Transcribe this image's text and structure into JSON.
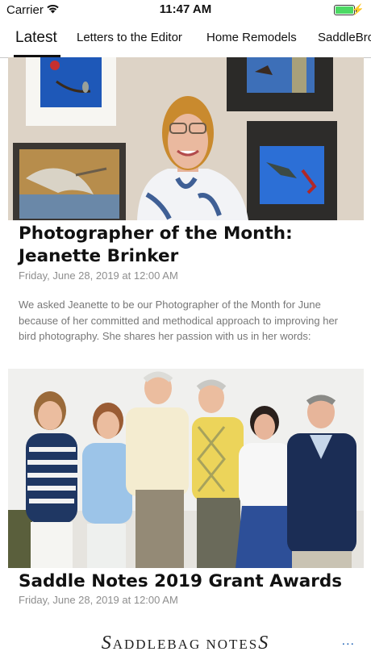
{
  "status_bar": {
    "carrier": "Carrier",
    "time": "11:47 AM",
    "wifi_icon": "wifi-icon",
    "battery_icon": "battery-icon",
    "charging_icon": "bolt-icon",
    "battery_color": "#4cd964"
  },
  "tabs": [
    {
      "label": "Latest",
      "active": true
    },
    {
      "label": "Letters to the Editor",
      "active": false
    },
    {
      "label": "Home Remodels",
      "active": false
    },
    {
      "label": "SaddleBro",
      "active": false
    }
  ],
  "articles": [
    {
      "title": "Photographer of the Month: Jeanette Brinker",
      "date": "Friday, June 28, 2019 at 12:00 AM",
      "summary": "We asked Jeanette to be our Photographer of the Month for June because of her committed and methodical approach to improving her bird photography. She shares her passion with us in her words:"
    },
    {
      "title": "Saddle Notes 2019 Grant Awards",
      "date": "Friday, June 28, 2019 at 12:00 AM"
    }
  ],
  "footer": {
    "logo": {
      "s": "S",
      "addlebag": "ADDLEBAG ",
      "notes": "NOTES",
      "s2": "S"
    },
    "more_label": "..."
  }
}
